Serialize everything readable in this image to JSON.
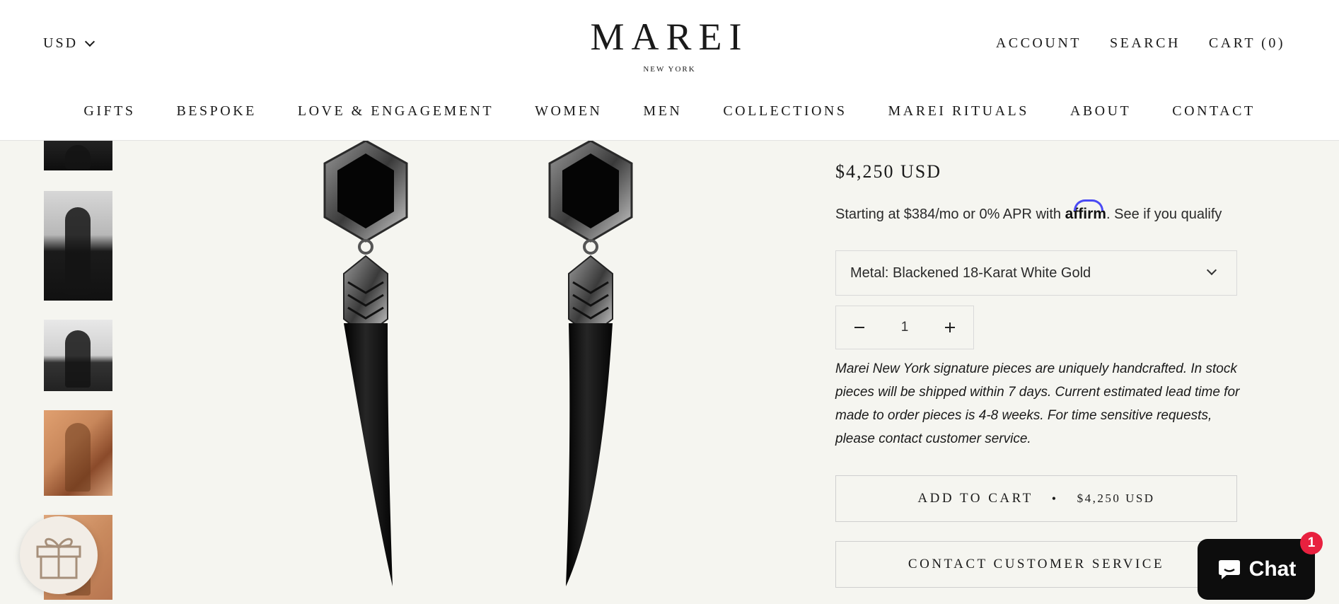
{
  "header": {
    "currency": "USD",
    "brand": "MAREI",
    "brand_sub": "NEW YORK",
    "top_links": {
      "account": "ACCOUNT",
      "search": "SEARCH",
      "cart": "CART (0)"
    },
    "main_nav": [
      "GIFTS",
      "BESPOKE",
      "LOVE & ENGAGEMENT",
      "WOMEN",
      "MEN",
      "COLLECTIONS",
      "MAREI RITUALS",
      "ABOUT",
      "CONTACT"
    ]
  },
  "product": {
    "price": "$4,250 USD",
    "financing": {
      "prefix": "Starting at $384/mo or 0% APR with",
      "provider": "affirm",
      "link": "See if you qualify"
    },
    "variant": "Metal: Blackened 18-Karat White Gold",
    "quantity": "1",
    "lead_time_note": "Marei New York signature pieces are uniquely handcrafted. In stock pieces will be shipped within 7 days. Current estimated lead time for made to order pieces is 4-8 weeks. For time sensitive requests, please contact customer service.",
    "add_to_cart_label": "ADD TO CART",
    "add_to_cart_price": "$4,250 USD",
    "contact_label": "CONTACT CUSTOMER SERVICE"
  },
  "chat": {
    "label": "Chat",
    "badge": "1"
  },
  "colors": {
    "background": "#f5f5f0",
    "text": "#1a1a1a",
    "chat_bg": "#0d0d0d",
    "badge": "#e8213f",
    "affirm_arc": "#4a4af4"
  },
  "icons": [
    "chevron-down-icon",
    "minus-icon",
    "plus-icon",
    "gift-icon",
    "chat-bubble-icon"
  ]
}
